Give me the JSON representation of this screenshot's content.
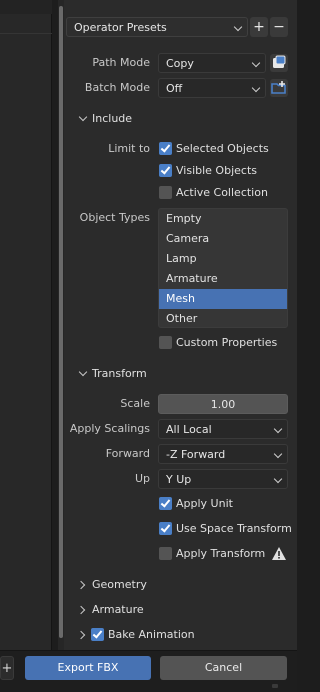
{
  "presets": {
    "label": "Operator Presets",
    "add": "+",
    "remove": "−"
  },
  "path_mode": {
    "label": "Path Mode",
    "value": "Copy"
  },
  "batch_mode": {
    "label": "Batch Mode",
    "value": "Off"
  },
  "include": {
    "title": "Include",
    "limit_to_label": "Limit to",
    "selected_objects": {
      "label": "Selected Objects",
      "checked": true
    },
    "visible_objects": {
      "label": "Visible Objects",
      "checked": true
    },
    "active_collection": {
      "label": "Active Collection",
      "checked": false
    },
    "object_types_label": "Object Types",
    "object_types": [
      "Empty",
      "Camera",
      "Lamp",
      "Armature",
      "Mesh",
      "Other"
    ],
    "selected_type": "Mesh",
    "custom_properties": {
      "label": "Custom Properties",
      "checked": false
    }
  },
  "transform": {
    "title": "Transform",
    "scale_label": "Scale",
    "scale_value": "1.00",
    "apply_scalings_label": "Apply Scalings",
    "apply_scalings_value": "All Local",
    "forward_label": "Forward",
    "forward_value": "-Z Forward",
    "up_label": "Up",
    "up_value": "Y Up",
    "apply_unit": {
      "label": "Apply Unit",
      "checked": true
    },
    "use_space_transform": {
      "label": "Use Space Transform",
      "checked": true
    },
    "apply_transform": {
      "label": "Apply Transform",
      "checked": false
    }
  },
  "geometry": {
    "title": "Geometry"
  },
  "armature": {
    "title": "Armature"
  },
  "bake_animation": {
    "title": "Bake Animation",
    "checked": true
  },
  "footer": {
    "left_plus": "+",
    "export": "Export FBX",
    "cancel": "Cancel"
  },
  "colors": {
    "accent": "#4772b3",
    "checkbox_on": "#4a7fc7",
    "export_button": "#4772b3"
  }
}
